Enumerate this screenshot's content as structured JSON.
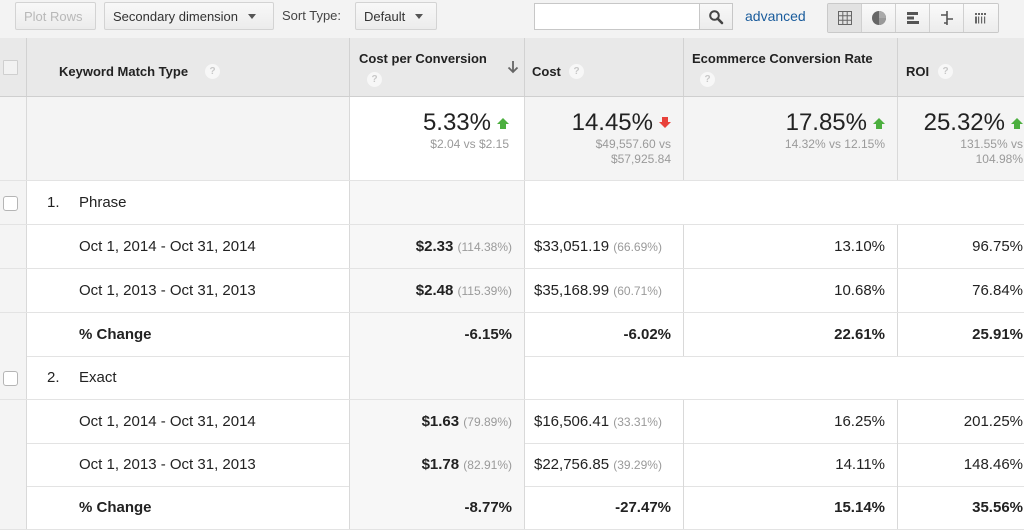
{
  "toolbar": {
    "plot_rows_label": "Plot Rows",
    "secondary_dimension_label": "Secondary dimension",
    "sort_type_label": "Sort Type:",
    "sort_type_value": "Default",
    "search_value": "",
    "search_placeholder": "",
    "advanced_link": "advanced",
    "view_buttons": [
      {
        "icon": "table-grid-icon",
        "active": true
      },
      {
        "icon": "pie-chart-icon",
        "active": false
      },
      {
        "icon": "bar-chart-icon",
        "active": false
      },
      {
        "icon": "comparison-icon",
        "active": false
      },
      {
        "icon": "pivot-icon",
        "active": false
      }
    ]
  },
  "table": {
    "headers": {
      "dimension": "Keyword Match Type",
      "cost_per_conversion": "Cost per Conversion",
      "cost": "Cost",
      "ecommerce_conversion_rate": "Ecommerce Conversion Rate",
      "roi": "ROI",
      "help": "?",
      "sort_icon": "sort-descending-arrow"
    },
    "summary": {
      "cost_per_conversion": {
        "change": "5.33%",
        "direction": "up",
        "detail": "$2.04 vs $2.15"
      },
      "cost": {
        "change": "14.45%",
        "direction": "down",
        "detail_line1": "$49,557.60 vs",
        "detail_line2": "$57,925.84"
      },
      "ecommerce_conversion_rate": {
        "change": "17.85%",
        "direction": "up",
        "detail": "14.32% vs 12.15%"
      },
      "roi": {
        "change": "25.32%",
        "direction": "up",
        "detail_line1": "131.55% vs",
        "detail_line2": "104.98%"
      }
    },
    "groups": [
      {
        "index": "1.",
        "name": "Phrase",
        "rows": [
          {
            "label": "Oct 1, 2014 - Oct 31, 2014",
            "cpc": "$2.33",
            "cpc_pct": "(114.38%)",
            "cost": "$33,051.19",
            "cost_pct": "(66.69%)",
            "ecr": "13.10%",
            "roi": "96.75%"
          },
          {
            "label": "Oct 1, 2013 - Oct 31, 2013",
            "cpc": "$2.48",
            "cpc_pct": "(115.39%)",
            "cost": "$35,168.99",
            "cost_pct": "(60.71%)",
            "ecr": "10.68%",
            "roi": "76.84%"
          }
        ],
        "change": {
          "label": "% Change",
          "cpc": "-6.15%",
          "cost": "-6.02%",
          "ecr": "22.61%",
          "roi": "25.91%"
        }
      },
      {
        "index": "2.",
        "name": "Exact",
        "rows": [
          {
            "label": "Oct 1, 2014 - Oct 31, 2014",
            "cpc": "$1.63",
            "cpc_pct": "(79.89%)",
            "cost": "$16,506.41",
            "cost_pct": "(33.31%)",
            "ecr": "16.25%",
            "roi": "201.25%"
          },
          {
            "label": "Oct 1, 2013 - Oct 31, 2013",
            "cpc": "$1.78",
            "cpc_pct": "(82.91%)",
            "cost": "$22,756.85",
            "cost_pct": "(39.29%)",
            "ecr": "14.11%",
            "roi": "148.46%"
          }
        ],
        "change": {
          "label": "% Change",
          "cpc": "-8.77%",
          "cost": "-27.47%",
          "ecr": "15.14%",
          "roi": "35.56%"
        }
      }
    ]
  },
  "colors": {
    "up": "#4caf3f",
    "down": "#e8413a",
    "link": "#1a5c9c"
  }
}
